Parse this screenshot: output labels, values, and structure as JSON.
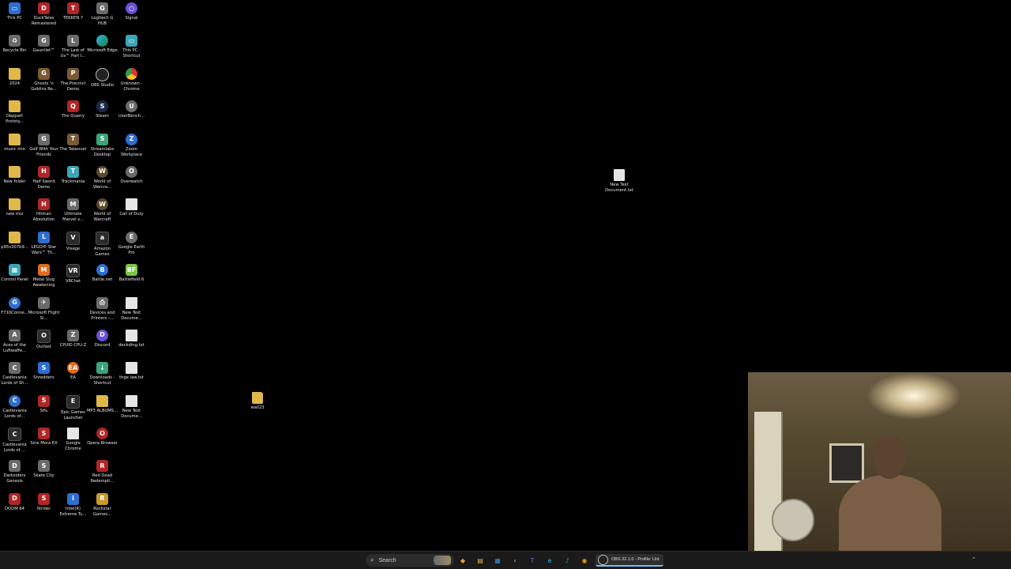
{
  "desktop": {
    "icons": [
      {
        "label": "This PC",
        "icon": "pc-icon",
        "style": "blue",
        "glyph": "▭"
      },
      {
        "label": "DuckTales Remastered",
        "icon": "game-icon",
        "style": "red",
        "glyph": "D"
      },
      {
        "label": "TEKKEN 7",
        "icon": "game-icon",
        "style": "red",
        "glyph": "T"
      },
      {
        "label": "Logitech G HUB",
        "icon": "logitech-icon",
        "style": "gray",
        "glyph": "G"
      },
      {
        "label": "Signal",
        "icon": "signal-icon",
        "style": "purple round",
        "glyph": "○"
      },
      {
        "label": "Recycle Bin",
        "icon": "recycle-bin-icon",
        "style": "gray",
        "glyph": "♻"
      },
      {
        "label": "Gauntlet™",
        "icon": "game-icon",
        "style": "gray",
        "glyph": "G"
      },
      {
        "label": "The Last of Us™ Part I...",
        "icon": "game-icon",
        "style": "gray",
        "glyph": "L"
      },
      {
        "label": "Microsoft Edge",
        "icon": "edge-icon",
        "style": "edge",
        "glyph": ""
      },
      {
        "label": "This PC - Shortcut",
        "icon": "pc-icon",
        "style": "teal",
        "glyph": "▭"
      },
      {
        "label": "2024",
        "icon": "folder-icon",
        "style": "folder",
        "glyph": ""
      },
      {
        "label": "Ghosts 'n Goblins Re...",
        "icon": "game-icon",
        "style": "brown",
        "glyph": "G"
      },
      {
        "label": "The Precinct Demo",
        "icon": "game-icon",
        "style": "brown",
        "glyph": "P"
      },
      {
        "label": "OBS Studio",
        "icon": "obs-icon",
        "style": "obs",
        "glyph": ""
      },
      {
        "label": "Unknown - Chrome",
        "icon": "chrome-icon",
        "style": "chrome",
        "glyph": ""
      },
      {
        "label": "Deppart Prototy...",
        "icon": "folder-icon",
        "style": "folder",
        "glyph": ""
      },
      {
        "label": "",
        "icon": "",
        "style": "",
        "glyph": ""
      },
      {
        "label": "The Quarry",
        "icon": "game-icon",
        "style": "red",
        "glyph": "Q"
      },
      {
        "label": "Steam",
        "icon": "steam-icon",
        "style": "steam round",
        "glyph": "S"
      },
      {
        "label": "UserBench...",
        "icon": "app-icon",
        "style": "gray round",
        "glyph": "U"
      },
      {
        "label": "music mix",
        "icon": "folder-icon",
        "style": "folder",
        "glyph": ""
      },
      {
        "label": "Golf With Your Friends",
        "icon": "game-icon",
        "style": "gray",
        "glyph": "G"
      },
      {
        "label": "The Takeover",
        "icon": "game-icon",
        "style": "brown",
        "glyph": "T"
      },
      {
        "label": "Streamlabs Desktop",
        "icon": "streamlabs-icon",
        "style": "green",
        "glyph": "S"
      },
      {
        "label": "Zoom Workplace",
        "icon": "zoom-icon",
        "style": "blue round",
        "glyph": "Z"
      },
      {
        "label": "New folder",
        "icon": "folder-icon",
        "style": "folder",
        "glyph": ""
      },
      {
        "label": "Half Sword Demo",
        "icon": "game-icon",
        "style": "red",
        "glyph": "H"
      },
      {
        "label": "Trackmania",
        "icon": "game-icon",
        "style": "teal",
        "glyph": "T"
      },
      {
        "label": "World of Warcra...",
        "icon": "wow-icon",
        "style": "wow round",
        "glyph": "W"
      },
      {
        "label": "Overwatch",
        "icon": "overwatch-icon",
        "style": "gray round",
        "glyph": "O"
      },
      {
        "label": "new mix",
        "icon": "folder-icon",
        "style": "folder",
        "glyph": ""
      },
      {
        "label": "Hitman Absolution",
        "icon": "game-icon",
        "style": "red",
        "glyph": "H"
      },
      {
        "label": "Ultimate Marvel v...",
        "icon": "game-icon",
        "style": "gray",
        "glyph": "M"
      },
      {
        "label": "World of Warcraft",
        "icon": "wow-icon",
        "style": "wow round",
        "glyph": "W"
      },
      {
        "label": "Call of Duty",
        "icon": "file-icon",
        "style": "file",
        "glyph": ""
      },
      {
        "label": "p95v307b9...",
        "icon": "folder-icon",
        "style": "folder",
        "glyph": ""
      },
      {
        "label": "LEGO® Star Wars™ Th...",
        "icon": "game-icon",
        "style": "blue",
        "glyph": "L"
      },
      {
        "label": "Visage",
        "icon": "game-icon",
        "style": "dark",
        "glyph": "V"
      },
      {
        "label": "Amazon Games",
        "icon": "amazon-icon",
        "style": "dark",
        "glyph": "a"
      },
      {
        "label": "Google Earth Pro",
        "icon": "earth-icon",
        "style": "gray round",
        "glyph": "E"
      },
      {
        "label": "Control Panel",
        "icon": "control-panel-icon",
        "style": "teal",
        "glyph": "▦"
      },
      {
        "label": "Metal Slug Awakening",
        "icon": "game-icon",
        "style": "orange",
        "glyph": "M"
      },
      {
        "label": "VRChat",
        "icon": "vrchat-icon",
        "style": "dark",
        "glyph": "VR"
      },
      {
        "label": "Battle.net",
        "icon": "battlenet-icon",
        "style": "blue round",
        "glyph": "B"
      },
      {
        "label": "Battlefield 6",
        "icon": "game-icon",
        "style": "lime",
        "glyph": "BF"
      },
      {
        "label": "F710Conne...",
        "icon": "logitech-icon",
        "style": "blue round",
        "glyph": "G"
      },
      {
        "label": "Microsoft Flight Si...",
        "icon": "game-icon",
        "style": "gray",
        "glyph": "✈"
      },
      {
        "label": "",
        "icon": "",
        "style": "",
        "glyph": ""
      },
      {
        "label": "Devices and Printers -...",
        "icon": "printer-icon",
        "style": "gray",
        "glyph": "⎙"
      },
      {
        "label": "New Text Docume...",
        "icon": "file-icon",
        "style": "file",
        "glyph": ""
      },
      {
        "label": "Aces of the Luftwaffe...",
        "icon": "game-icon",
        "style": "gray",
        "glyph": "A"
      },
      {
        "label": "Outlast",
        "icon": "game-icon",
        "style": "dark",
        "glyph": "O"
      },
      {
        "label": "CPUID CPU-Z",
        "icon": "cpuz-icon",
        "style": "gray",
        "glyph": "Z"
      },
      {
        "label": "Discord",
        "icon": "discord-icon",
        "style": "purple round",
        "glyph": "D"
      },
      {
        "label": "deckding.txt",
        "icon": "file-icon",
        "style": "file",
        "glyph": ""
      },
      {
        "label": "Castlevania Lords of Sh...",
        "icon": "game-icon",
        "style": "gray",
        "glyph": "C"
      },
      {
        "label": "Shredders",
        "icon": "game-icon",
        "style": "blue",
        "glyph": "S"
      },
      {
        "label": "EA",
        "icon": "ea-icon",
        "style": "orange round",
        "glyph": "EA"
      },
      {
        "label": "Downloads - Shortcut",
        "icon": "folder-icon",
        "style": "green",
        "glyph": "↓"
      },
      {
        "label": "thge law.txt",
        "icon": "file-icon",
        "style": "file",
        "glyph": ""
      },
      {
        "label": "Castlevania Lords of...",
        "icon": "game-icon",
        "style": "blue round",
        "glyph": "C"
      },
      {
        "label": "Sifu",
        "icon": "game-icon",
        "style": "red",
        "glyph": "S"
      },
      {
        "label": "Epic Games Launcher",
        "icon": "epic-icon",
        "style": "dark",
        "glyph": "E"
      },
      {
        "label": "MP3 ALBUMS...",
        "icon": "folder-icon",
        "style": "folder",
        "glyph": ""
      },
      {
        "label": "New Text Docume...",
        "icon": "file-icon",
        "style": "file",
        "glyph": ""
      },
      {
        "label": "Castlevania Lords of ...",
        "icon": "game-icon",
        "style": "dark",
        "glyph": "C"
      },
      {
        "label": "Sine Mora EX",
        "icon": "game-icon",
        "style": "red",
        "glyph": "S"
      },
      {
        "label": "Google Chrome",
        "icon": "file-icon",
        "style": "file",
        "glyph": ""
      },
      {
        "label": "Opera Browser",
        "icon": "opera-icon",
        "style": "red round",
        "glyph": "O"
      },
      {
        "label": "",
        "icon": "",
        "style": "",
        "glyph": ""
      },
      {
        "label": "Darksiders Genesis",
        "icon": "game-icon",
        "style": "gray",
        "glyph": "D"
      },
      {
        "label": "Skate City",
        "icon": "game-icon",
        "style": "gray",
        "glyph": "S"
      },
      {
        "label": "",
        "icon": "",
        "style": "",
        "glyph": ""
      },
      {
        "label": "Red Dead Redempti...",
        "icon": "game-icon",
        "style": "red",
        "glyph": "R"
      },
      {
        "label": "",
        "icon": "",
        "style": "",
        "glyph": ""
      },
      {
        "label": "DOOM 64",
        "icon": "game-icon",
        "style": "red",
        "glyph": "D"
      },
      {
        "label": "Strider",
        "icon": "game-icon",
        "style": "red",
        "glyph": "S"
      },
      {
        "label": "Intel(R) Extreme Tu...",
        "icon": "intel-icon",
        "style": "blue",
        "glyph": "i"
      },
      {
        "label": "Rockstar Games...",
        "icon": "rockstar-icon",
        "style": "gold",
        "glyph": "R"
      },
      {
        "label": "",
        "icon": "",
        "style": "",
        "glyph": ""
      }
    ],
    "free_file": {
      "label": "New Text Document.txt"
    },
    "free_folder": {
      "label": "wall23"
    }
  },
  "taskbar": {
    "search_placeholder": "Search",
    "obs_task_label": "OBS 32.1.0 - Profile: Unt",
    "pinned": [
      {
        "name": "copilot-icon",
        "glyph": "◆",
        "color": "#e0a33a"
      },
      {
        "name": "file-explorer-icon",
        "glyph": "▤",
        "color": "#e6b84a"
      },
      {
        "name": "calendar-icon",
        "glyph": "▦",
        "color": "#3a8ee0"
      },
      {
        "name": "back-arrow-icon",
        "glyph": "‹",
        "color": "#cccccc"
      },
      {
        "name": "teams-icon",
        "glyph": "T",
        "color": "#6b6bd8"
      },
      {
        "name": "edge-icon",
        "glyph": "e",
        "color": "#2db4e6"
      },
      {
        "name": "spotify-icon",
        "glyph": "♪",
        "color": "#1db954"
      },
      {
        "name": "chrome-icon",
        "glyph": "◉",
        "color": "#e0a020"
      }
    ]
  }
}
